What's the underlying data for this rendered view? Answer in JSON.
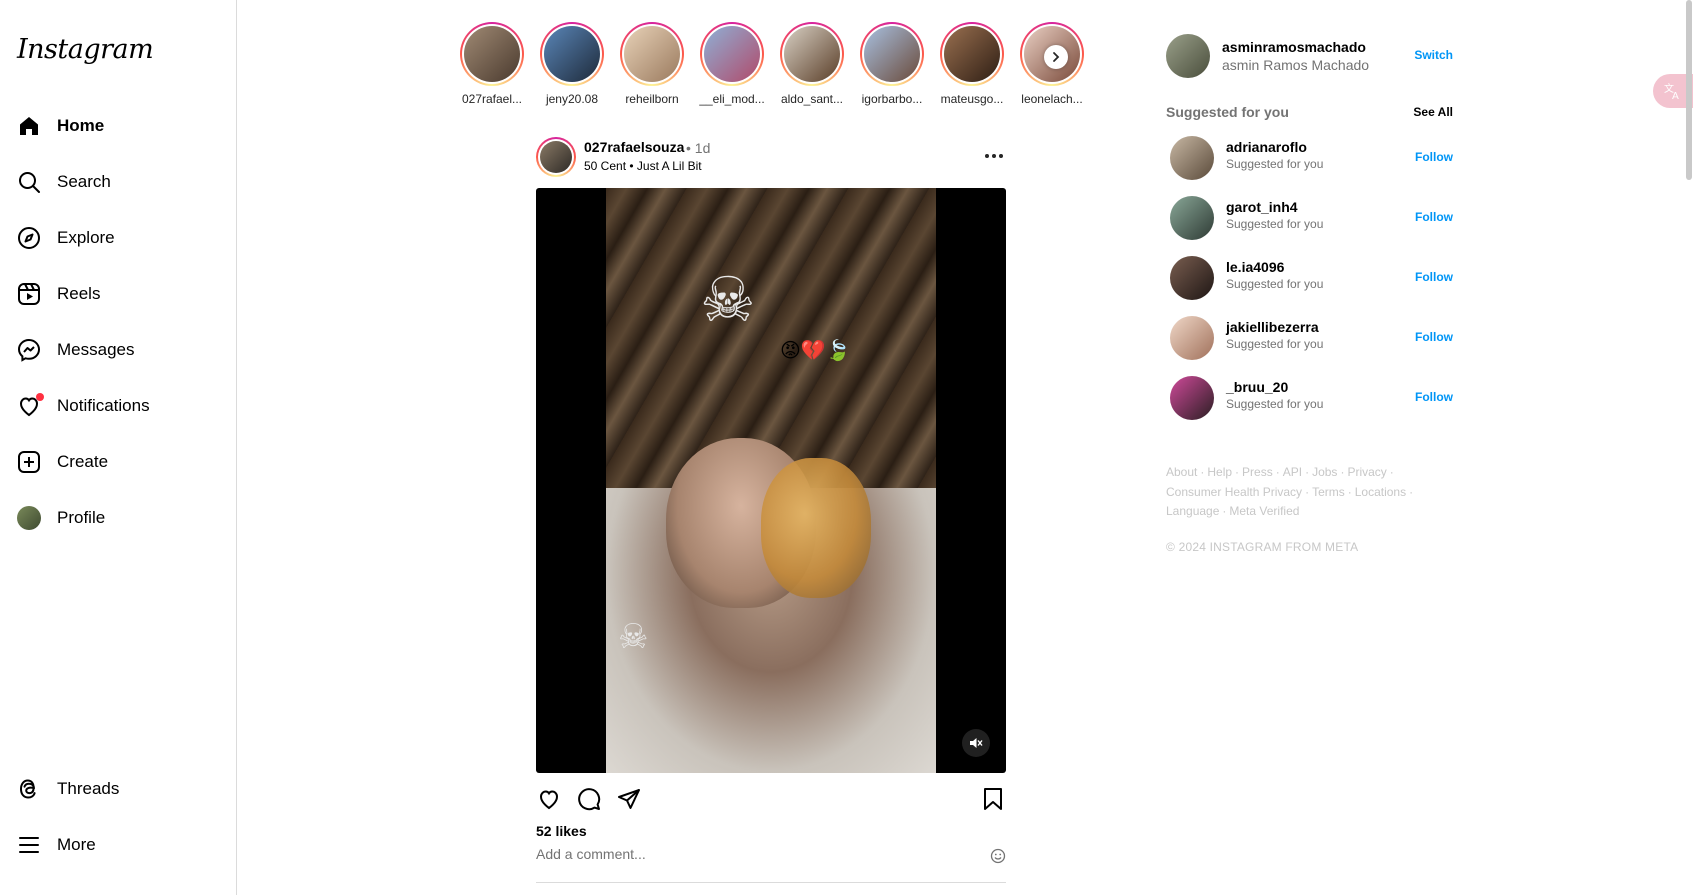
{
  "app": {
    "logo": "Instagram"
  },
  "sidebar": {
    "items": [
      {
        "label": "Home",
        "icon": "home-icon",
        "active": true
      },
      {
        "label": "Search",
        "icon": "search-icon"
      },
      {
        "label": "Explore",
        "icon": "compass-icon"
      },
      {
        "label": "Reels",
        "icon": "reels-icon"
      },
      {
        "label": "Messages",
        "icon": "messenger-icon"
      },
      {
        "label": "Notifications",
        "icon": "heart-icon",
        "badge": true
      },
      {
        "label": "Create",
        "icon": "plus-square-icon"
      },
      {
        "label": "Profile",
        "icon": "avatar"
      }
    ],
    "bottom": [
      {
        "label": "Threads",
        "icon": "threads-icon"
      },
      {
        "label": "More",
        "icon": "hamburger-icon"
      }
    ]
  },
  "stories": [
    {
      "name": "027rafael...",
      "color": "#6b5a4a"
    },
    {
      "name": "jeny20.08",
      "color": "#2f4b6e"
    },
    {
      "name": "reheilborn",
      "color": "#c7a98a"
    },
    {
      "name": "__eli_mod...",
      "color": "#b07a7a"
    },
    {
      "name": "aldo_sant...",
      "color": "#7a5a3a"
    },
    {
      "name": "igorbarbo...",
      "color": "#8aa0c0"
    },
    {
      "name": "mateusgo...",
      "color": "#6a4a34"
    },
    {
      "name": "leonelach...",
      "color": "#c99a8e"
    }
  ],
  "post": {
    "username": "027rafaelsouza",
    "time": "• 1d",
    "audio": "50 Cent • Just A Lil Bit",
    "likes": "52 likes",
    "comment_placeholder": "Add a comment..."
  },
  "right": {
    "me": {
      "username": "asminramosmachado",
      "name": "asmin Ramos Machado",
      "switch": "Switch"
    },
    "suggestions_title": "Suggested for you",
    "see_all": "See All",
    "suggestions": [
      {
        "username": "adrianaroflo",
        "sub": "Suggested for you",
        "action": "Follow",
        "color": "#8a7a6a"
      },
      {
        "username": "garot_inh4",
        "sub": "Suggested for you",
        "action": "Follow",
        "color": "#5a7a6a"
      },
      {
        "username": "le.ia4096",
        "sub": "Suggested for you",
        "action": "Follow",
        "color": "#4a3a34"
      },
      {
        "username": "jakiellibezerra",
        "sub": "Suggested for you",
        "action": "Follow",
        "color": "#c9a08a"
      },
      {
        "username": "_bruu_20",
        "sub": "Suggested for you",
        "action": "Follow",
        "color": "#3a2a2e"
      }
    ],
    "footer_links": [
      "About",
      "Help",
      "Press",
      "API",
      "Jobs",
      "Privacy",
      "Consumer Health Privacy",
      "Terms",
      "Locations",
      "Language",
      "Meta Verified"
    ],
    "copyright": "© 2024 INSTAGRAM FROM META"
  },
  "colors": {
    "accent": "#0095f6",
    "badge": "#ff3040",
    "muted": "#737373",
    "footer": "#c7c7c7"
  }
}
